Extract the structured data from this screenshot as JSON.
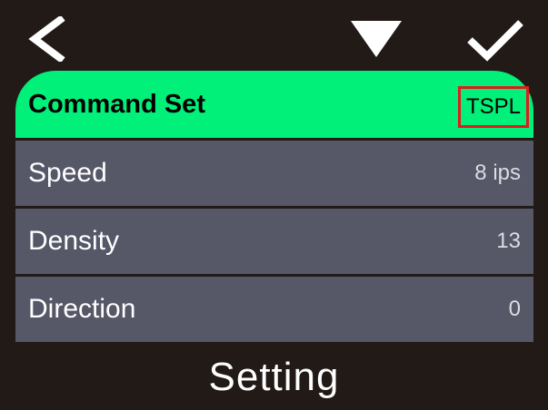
{
  "header": {
    "back_icon": "chevron-left-icon",
    "menu_icon": "triangle-down-icon",
    "confirm_icon": "checkmark-icon"
  },
  "settings": {
    "items": [
      {
        "label": "Command Set",
        "value": "TSPL"
      },
      {
        "label": "Speed",
        "value": "8 ips"
      },
      {
        "label": "Density",
        "value": "13"
      },
      {
        "label": "Direction",
        "value": "0"
      }
    ]
  },
  "footer": {
    "title": "Setting"
  },
  "colors": {
    "background": "#211a16",
    "selected_row": "#00f07a",
    "row": "#565767",
    "highlight_box": "#e21a1a"
  }
}
